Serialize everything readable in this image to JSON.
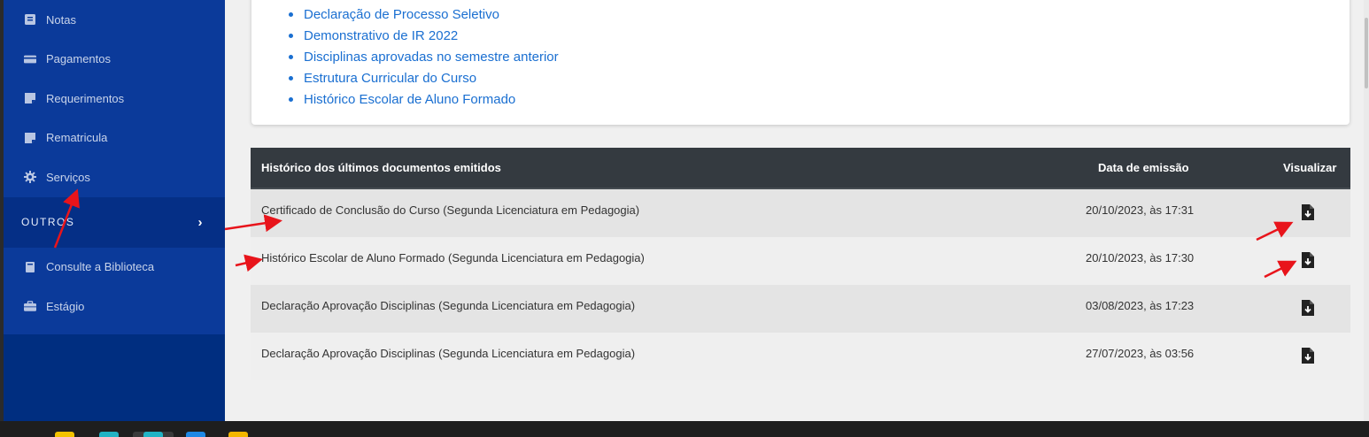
{
  "sidebar": {
    "items": [
      {
        "label": "Notas",
        "icon": "notes-icon"
      },
      {
        "label": "Pagamentos",
        "icon": "credit-card-icon"
      },
      {
        "label": "Requerimentos",
        "icon": "sticky-note-icon"
      },
      {
        "label": "Rematricula",
        "icon": "sticky-note-icon"
      },
      {
        "label": "Serviços",
        "icon": "gear-icon"
      }
    ],
    "outros_label": "OUTROS",
    "extra_items": [
      {
        "label": "Consulte a Biblioteca",
        "icon": "book-icon"
      },
      {
        "label": "Estágio",
        "icon": "briefcase-icon"
      }
    ]
  },
  "documents": {
    "links": [
      "Declaração de Processo Seletivo",
      "Demonstrativo de IR 2022",
      "Disciplinas aprovadas no semestre anterior",
      "Estrutura Curricular do Curso",
      "Histórico Escolar de Aluno Formado"
    ]
  },
  "history": {
    "headers": {
      "document": "Histórico dos últimos documentos emitidos",
      "date": "Data de emissão",
      "view": "Visualizar"
    },
    "rows": [
      {
        "document": "Certificado de Conclusão do Curso (Segunda Licenciatura em Pedagogia)",
        "date": "20/10/2023, às 17:31"
      },
      {
        "document": "Histórico Escolar de Aluno Formado (Segunda Licenciatura em Pedagogia)",
        "date": "20/10/2023, às 17:30"
      },
      {
        "document": "Declaração Aprovação Disciplinas (Segunda Licenciatura em Pedagogia)",
        "date": "03/08/2023, às 17:23"
      },
      {
        "document": "Declaração Aprovação Disciplinas (Segunda Licenciatura em Pedagogia)",
        "date": "27/07/2023, às 03:56"
      }
    ]
  },
  "colors": {
    "sidebar_bg": "#002e80",
    "link": "#1a6fd1",
    "table_header": "#343a40",
    "annotation_arrow": "#e8141b"
  }
}
